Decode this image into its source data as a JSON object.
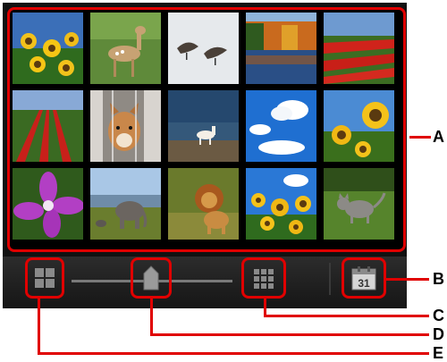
{
  "callouts": {
    "a": "A",
    "b": "B",
    "c": "C",
    "d": "D",
    "e": "E"
  },
  "toolbar": {
    "date_icon_day": "31"
  },
  "photos": [
    "sunflowers-photo",
    "deer-photo",
    "birds-in-snow-photo",
    "autumn-lake-photo",
    "tulip-field-photo",
    "tulip-rows-photo",
    "dog-in-doorway-photo",
    "horse-on-beach-photo",
    "blue-sky-clouds-photo",
    "sunflowers-closeup-photo",
    "purple-flower-photo",
    "elephant-photo",
    "lion-photo",
    "sunflowers-sky-photo",
    "cat-on-grass-photo"
  ]
}
